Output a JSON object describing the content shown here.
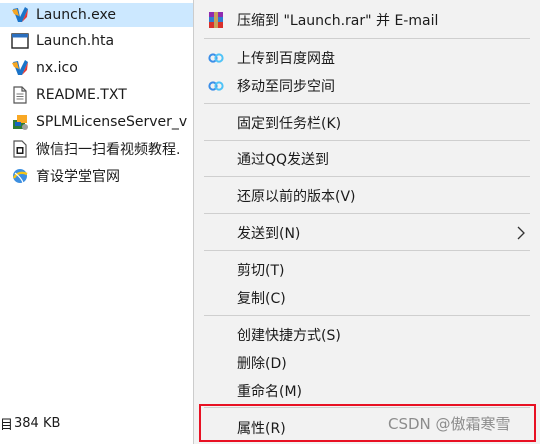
{
  "files": [
    {
      "name": "Launch.exe",
      "icon": "nx-logo-icon",
      "selected": true
    },
    {
      "name": "Launch.hta",
      "icon": "application-window-icon"
    },
    {
      "name": "nx.ico",
      "icon": "nx-logo-icon"
    },
    {
      "name": "README.TXT",
      "icon": "text-document-icon"
    },
    {
      "name": "SPLMLicenseServer_v",
      "icon": "installer-package-icon"
    },
    {
      "name": "微信扫一扫看视频教程.",
      "icon": "image-file-icon"
    },
    {
      "name": "育设学堂官网",
      "icon": "internet-shortcut-icon"
    }
  ],
  "status_bar": {
    "left": "目",
    "size": "384 KB"
  },
  "context_menu": {
    "items": {
      "compress_email": "压缩到 \"Launch.rar\" 并 E-mail",
      "upload_baidu": "上传到百度网盘",
      "move_sync": "移动至同步空间",
      "pin_taskbar": "固定到任务栏(K)",
      "send_qq": "通过QQ发送到",
      "restore_version": "还原以前的版本(V)",
      "send_to": "发送到(N)",
      "cut": "剪切(T)",
      "copy": "复制(C)",
      "create_shortcut": "创建快捷方式(S)",
      "delete": "删除(D)",
      "rename": "重命名(M)",
      "properties": "属性(R)"
    }
  },
  "watermark": "CSDN @傲霜寒雪",
  "colors": {
    "selection": "#cce8ff",
    "menu_bg": "#f2f2f2",
    "highlight_border": "#e81123",
    "baidu_blue": "#3b8ee8"
  }
}
